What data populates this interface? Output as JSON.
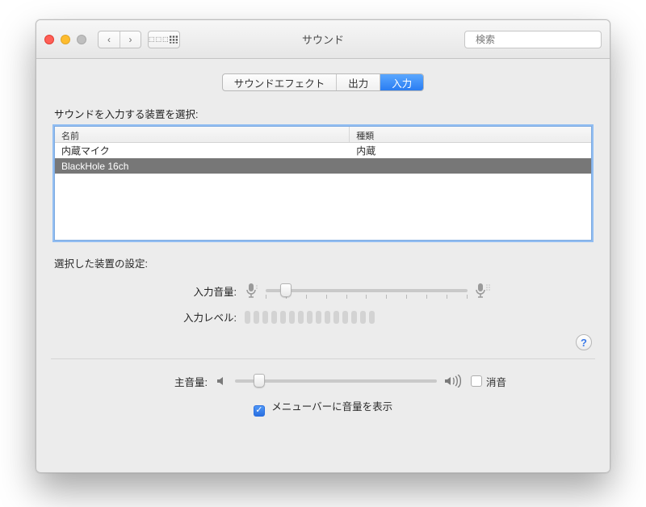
{
  "window": {
    "title": "サウンド",
    "search_placeholder": "検索"
  },
  "tabs": {
    "effects": "サウンドエフェクト",
    "output": "出力",
    "input": "入力",
    "active": "input"
  },
  "section": {
    "select_input_device": "サウンドを入力する装置を選択:",
    "columns": {
      "name": "名前",
      "kind": "種類"
    },
    "devices": [
      {
        "name": "内蔵マイク",
        "kind": "内蔵",
        "selected": false
      },
      {
        "name": "BlackHole 16ch",
        "kind": "",
        "selected": true
      }
    ],
    "selected_settings": "選択した装置の設定:"
  },
  "controls": {
    "input_volume_label": "入力音量:",
    "input_volume_pct": 10,
    "input_level_label": "入力レベル:",
    "master_volume_label": "主音量:",
    "master_volume_pct": 12,
    "mute_label": "消音",
    "mute_checked": false,
    "show_in_menubar_label": "メニューバーに音量を表示",
    "show_in_menubar_checked": true
  },
  "icons": {
    "back": "‹",
    "forward": "›",
    "grid": "⋮⋮⋮",
    "search": "🔍",
    "mic_low": "mic-low",
    "mic_high": "mic-high",
    "speaker_low": "speaker-low",
    "speaker_high": "speaker-high",
    "help": "?"
  }
}
